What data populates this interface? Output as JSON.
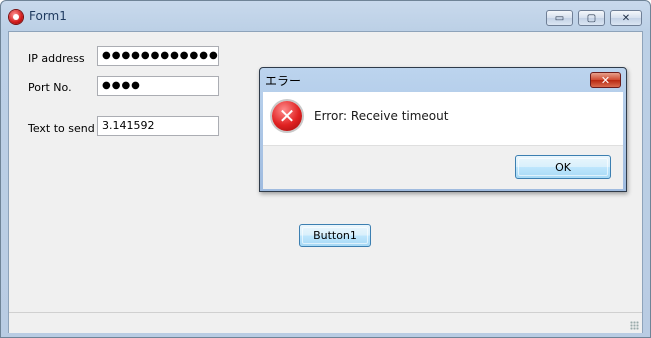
{
  "window": {
    "title": "Form1",
    "controls": {
      "minimize": "▭",
      "maximize": "▢",
      "close": "✕"
    }
  },
  "form": {
    "ip_label": "IP address",
    "ip_value": "●●●●●●●●●●●●●●",
    "port_label": "Port No.",
    "port_value": "●●●●",
    "text_label": "Text to send",
    "text_value": "3.141592",
    "button_label": "Button1"
  },
  "dialog": {
    "title": "エラー",
    "close_glyph": "✕",
    "icon_glyph": "✕",
    "message": "Error: Receive timeout",
    "ok_label": "OK"
  }
}
